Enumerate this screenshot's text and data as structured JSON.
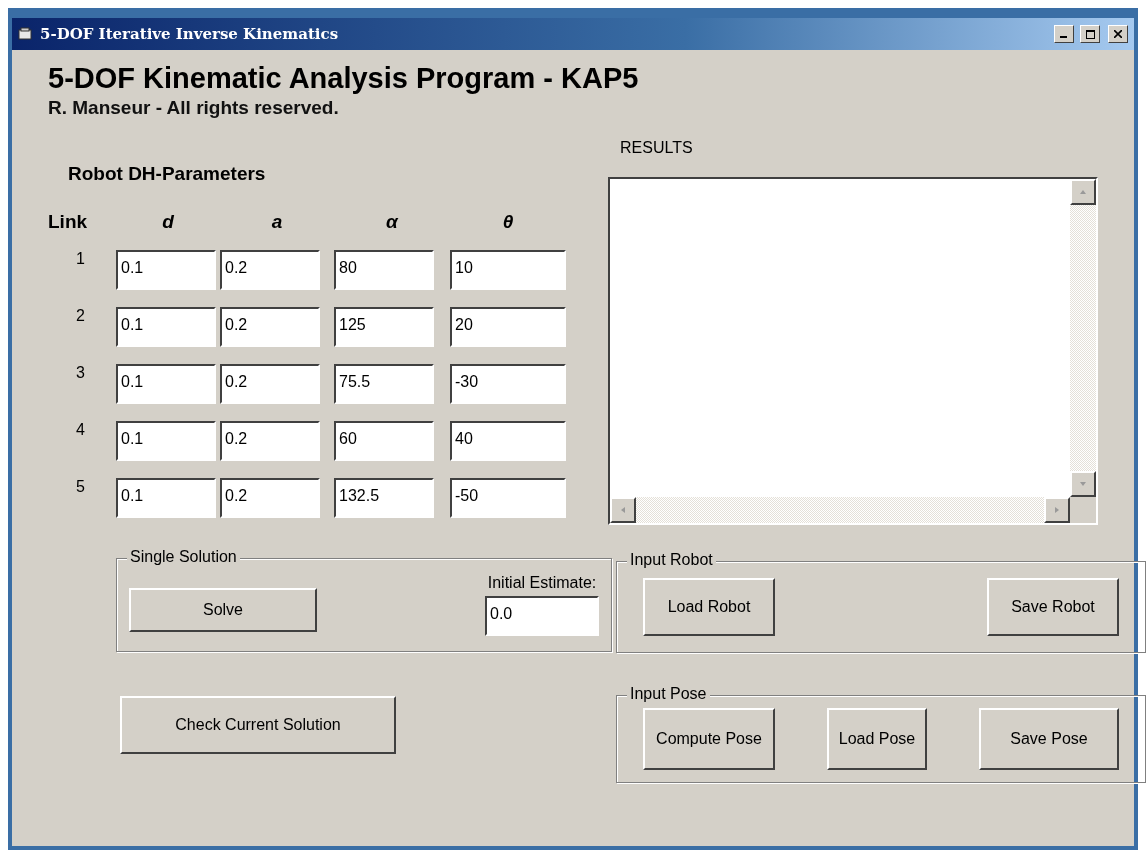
{
  "window": {
    "title": "5-DOF Iterative Inverse Kinematics"
  },
  "header": {
    "title": "5-DOF Kinematic Analysis Program - KAP5",
    "subtitle": "R. Manseur - All rights reserved."
  },
  "dh_parameters": {
    "title": "Robot DH-Parameters",
    "link_heading": "Link",
    "columns": [
      "d",
      "a",
      "α",
      "θ"
    ],
    "rows": [
      {
        "link": "1",
        "values": [
          "0.1",
          "0.2",
          "80",
          "10"
        ]
      },
      {
        "link": "2",
        "values": [
          "0.1",
          "0.2",
          "125",
          "20"
        ]
      },
      {
        "link": "3",
        "values": [
          "0.1",
          "0.2",
          "75.5",
          "-30"
        ]
      },
      {
        "link": "4",
        "values": [
          "0.1",
          "0.2",
          "60",
          "40"
        ]
      },
      {
        "link": "5",
        "values": [
          "0.1",
          "0.2",
          "132.5",
          "-50"
        ]
      }
    ]
  },
  "single_solution": {
    "legend": "Single Solution",
    "button": "Solve",
    "estimate_label": "Initial Estimate:",
    "estimate_value": "0.0"
  },
  "check_button": "Check Current Solution",
  "results": {
    "label": "RESULTS"
  },
  "input_robot": {
    "legend": "Input Robot",
    "buttons": [
      "Load Robot",
      "Save Robot"
    ]
  },
  "input_pose": {
    "legend": "Input Pose",
    "buttons": [
      "Compute Pose",
      "Load Pose",
      "Save Pose"
    ]
  }
}
